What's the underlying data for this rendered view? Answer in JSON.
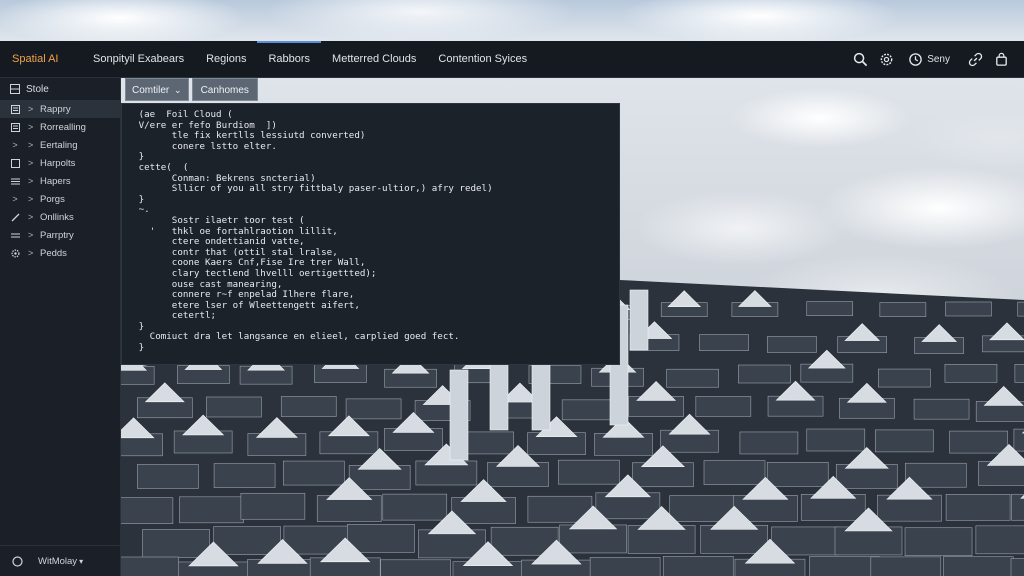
{
  "app": {
    "brand": "Spatial AI"
  },
  "nav": {
    "tabs": [
      {
        "label": "Sonpityil Exabears",
        "active": false
      },
      {
        "label": "Regions",
        "active": false
      },
      {
        "label": "Rabbors",
        "active": true
      },
      {
        "label": "Metterred Clouds",
        "active": false
      },
      {
        "label": "Contention Syices",
        "active": false
      }
    ]
  },
  "topbar": {
    "icons": [
      "search-icon",
      "settings-icon",
      "clock-icon",
      "link-icon",
      "bag-icon"
    ],
    "user_label": "Seny"
  },
  "sidebar": {
    "header": "Stole",
    "items": [
      {
        "label": "Rappry",
        "icon": "doc-icon",
        "selected": true
      },
      {
        "label": "Rorrealling",
        "icon": "doc-icon",
        "selected": false
      },
      {
        "label": "Eertaling",
        "icon": "",
        "selected": false
      },
      {
        "label": "Harpolts",
        "icon": "doc-icon",
        "selected": false
      },
      {
        "label": "Hapers",
        "icon": "list-icon",
        "selected": false
      },
      {
        "label": "Porgs",
        "icon": "",
        "selected": false
      },
      {
        "label": "Onllinks",
        "icon": "link-icon",
        "selected": false
      },
      {
        "label": "Parrptry",
        "icon": "list-icon",
        "selected": false
      },
      {
        "label": "Pedds",
        "icon": "gear-icon",
        "selected": false
      }
    ],
    "footer": "WitMolay"
  },
  "subtabs": [
    {
      "label": "Comtiler"
    },
    {
      "label": "Canhomes"
    }
  ],
  "code": {
    "lines": [
      "   (ae  Foil Cloud (",
      "   V/ere er fefo Burdiom  ])",
      "         tle fix kertlls lessiutd converted)",
      "         conere lstto elter.",
      "   }",
      "   cette(  (",
      "         Conman: Bekrens sncterial)",
      "         Sllicr of you all stry fittbaly paser-ultior,) afry redel)",
      "   }",
      "   ~.",
      "         Sostr ilaetr toor test (",
      "     '   thkl oe fortahlraotion lillit,",
      "         ctere ondettianid vatte,",
      "         contr that (ottil stal lralse,",
      "         coone Kaers Cnf,Fise Ire trer Wall,",
      "         clary tectlend lhvelll oertigettted);",
      "         ouse cast manearing,",
      "         connere r~f enpelad Ilhere flare,",
      "         etere lser of Wleettengett aifert,",
      "         cetertl;",
      "   }",
      "     Comiuct dra let langsance en elieel, carplied goed fect.",
      "   }"
    ]
  },
  "colors": {
    "brand": "#f2a24a",
    "topbar_bg": "#151a21",
    "sidebar_bg": "#1b2028",
    "code_bg": "#1c222a",
    "active_tab": "#5b8fd6"
  }
}
